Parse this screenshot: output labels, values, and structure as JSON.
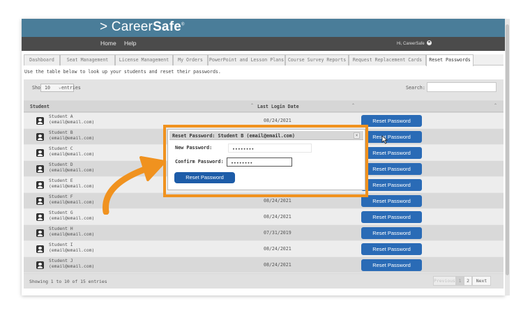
{
  "brand": {
    "prefix": "> Career",
    "bold": "Safe",
    "mark": "®"
  },
  "nav": {
    "home": "Home",
    "help": "Help",
    "user": "Hi, CareerSafe"
  },
  "tabs": [
    "Dashboard",
    "Seat Management",
    "License Management",
    "My Orders",
    "PowerPoint and Lesson Plans",
    "Course Survey Reports",
    "Request Replacement Cards",
    "Reset Passwords"
  ],
  "active_tab": "Reset Passwords",
  "instructions": "Use the table below to look up your students and reset their passwords.",
  "controls": {
    "show_label": "Show",
    "entries_value": "10",
    "entries_label": "entries",
    "search_label": "Search:",
    "search_value": ""
  },
  "table": {
    "headers": {
      "student": "Student",
      "last_login": "Last Login Date"
    },
    "rows": [
      {
        "name": "Student A",
        "email": "(email@email.com)",
        "date": "08/24/2021",
        "button": "Reset Password"
      },
      {
        "name": "Student B",
        "email": "(email@email.com)",
        "date": "",
        "button": "Reset Password"
      },
      {
        "name": "Student C",
        "email": "(email@email.com)",
        "date": "",
        "button": "Reset Password"
      },
      {
        "name": "Student D",
        "email": "(email@email.com)",
        "date": "",
        "button": "Reset Password"
      },
      {
        "name": "Student E",
        "email": "(email@email.com)",
        "date": "",
        "button": "Reset Password"
      },
      {
        "name": "Student F",
        "email": "(email@email.com)",
        "date": "08/24/2021",
        "button": "Reset Password"
      },
      {
        "name": "Student G",
        "email": "(email@email.com)",
        "date": "08/24/2021",
        "button": "Reset Password"
      },
      {
        "name": "Student H",
        "email": "(email@email.com)",
        "date": "07/31/2019",
        "button": "Reset Password"
      },
      {
        "name": "Student I",
        "email": "(email@email.com)",
        "date": "08/24/2021",
        "button": "Reset Password"
      },
      {
        "name": "Student J",
        "email": "(email@email.com)",
        "date": "08/24/2021",
        "button": "Reset Password"
      }
    ]
  },
  "footer": {
    "showing": "Showing 1 to 10 of 15 entries",
    "previous": "Previous",
    "page1": "1",
    "page2": "2",
    "next": "Next"
  },
  "modal": {
    "title": "Reset Password: Student B (email@email.com)",
    "close": "×",
    "new_password_label": "New Password:",
    "new_password_value": "••••••••",
    "confirm_password_label": "Confirm Password:",
    "confirm_password_value": "••••••••",
    "button": "Reset Password"
  },
  "colors": {
    "brand": "#4a7d99",
    "navbar": "#4b4b4b",
    "button": "#2a6bb6",
    "highlight": "#f0921f"
  }
}
